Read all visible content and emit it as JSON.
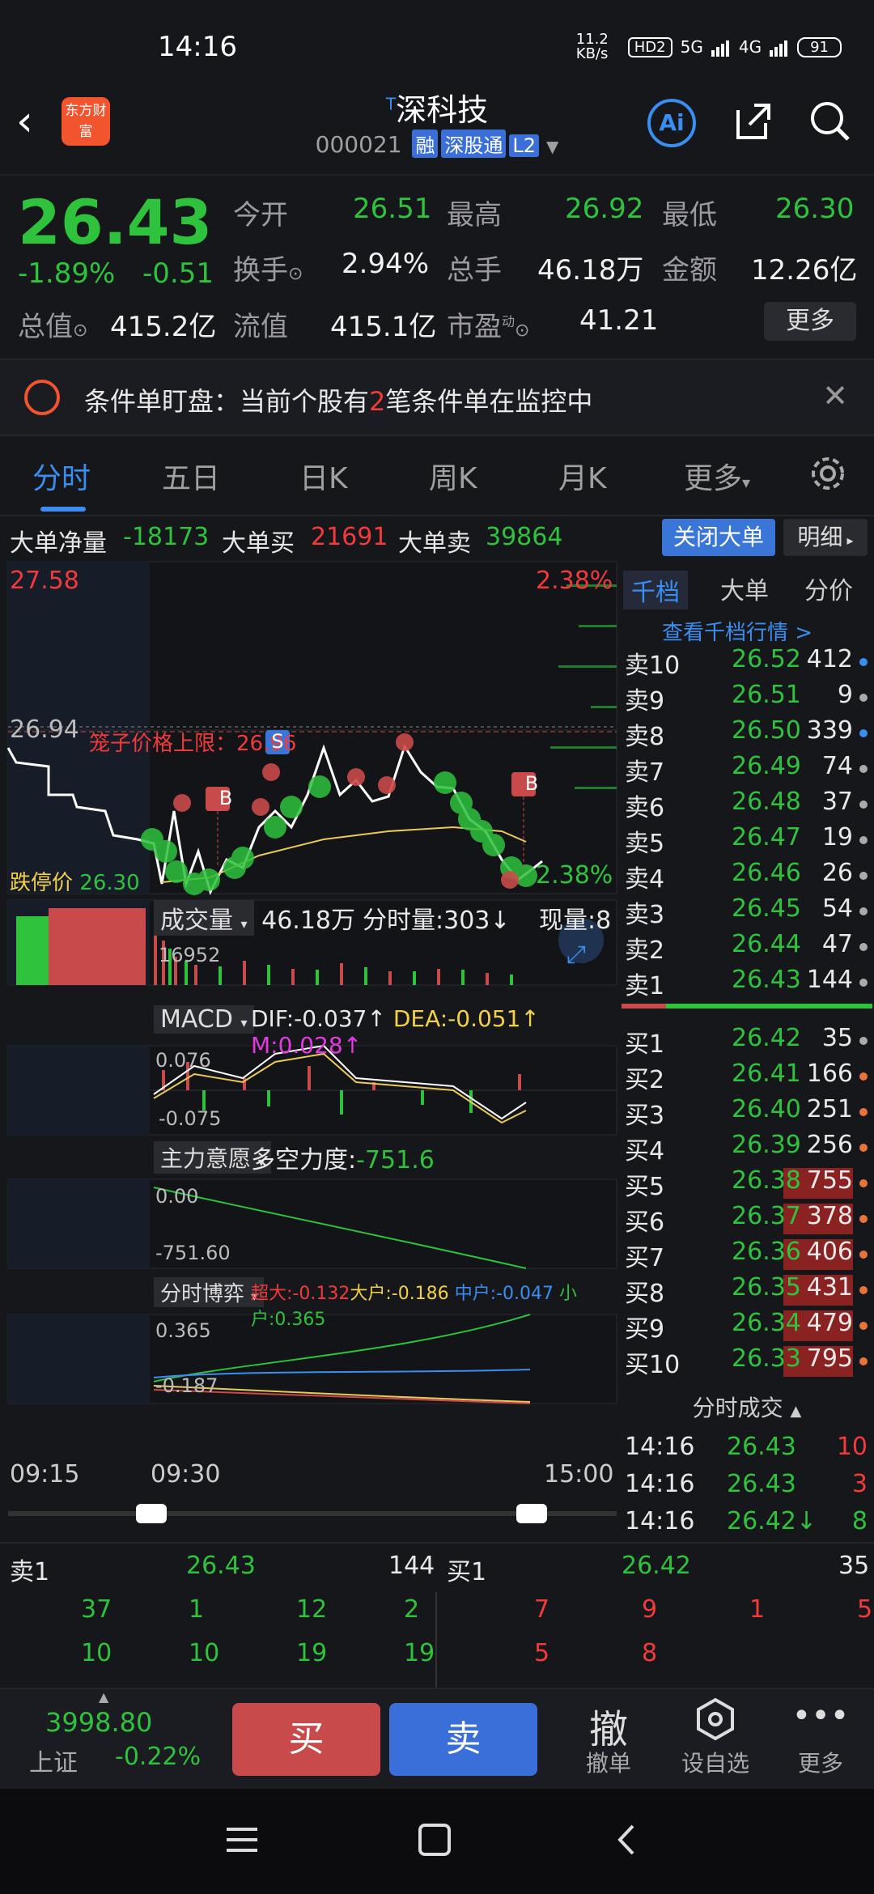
{
  "status": {
    "time": "14:16",
    "net_speed": "11.2 KB/s",
    "hd": "HD2",
    "sig1": "5G",
    "sig2": "4G",
    "battery": "91"
  },
  "header": {
    "logo": "东方财富",
    "title": "深科技",
    "title_sup": "T",
    "code": "000021",
    "tags": [
      "融",
      "深股通",
      "L2"
    ],
    "ai_label": "Ai"
  },
  "quote": {
    "price": "26.43",
    "change_pct": "-1.89%",
    "change": "-0.51",
    "open_label": "今开",
    "open": "26.51",
    "high_label": "最高",
    "high": "26.92",
    "low_label": "最低",
    "low": "26.30",
    "turnover_label": "换手",
    "turnover": "2.94%",
    "volume_label": "总手",
    "volume": "46.18万",
    "amount_label": "金额",
    "amount": "12.26亿",
    "mktcap_label": "总值",
    "mktcap": "415.2亿",
    "float_label": "流值",
    "float": "415.1亿",
    "pe_label": "市盈",
    "pe_sup": "动",
    "pe": "41.21",
    "more": "更多"
  },
  "notice": {
    "prefix": "条件单盯盘：当前个股有",
    "count": "2",
    "suffix": "笔条件单在监控中"
  },
  "tabs": [
    "分时",
    "五日",
    "日K",
    "周K",
    "月K",
    "更多"
  ],
  "bigorder": {
    "net_label": "大单净量",
    "net": "-18173",
    "buy_label": "大单买",
    "buy": "21691",
    "sell_label": "大单卖",
    "sell": "39864",
    "close_btn": "关闭大单",
    "detail_btn": "明细"
  },
  "chart": {
    "price_high": "27.58",
    "pct_high": "2.38%",
    "ref_price": "26.94",
    "cage_label": "笼子价格上限：",
    "cage_val": "26.96",
    "low_label": "跌停价",
    "low_price": "26.30",
    "pct_low": "2.38%",
    "vol_label": "成交量",
    "vol_total": "46.18万",
    "vol_min_label": "分时量:303↓",
    "vol_now_label": "现量:8",
    "vol_max": "16952",
    "macd_label": "MACD",
    "dif": "DIF:-0.037↑",
    "dea": "DEA:-0.051↑",
    "m": "M:0.028↑",
    "macd_hi": "0.076",
    "macd_lo": "-0.075",
    "zl_label": "主力意愿",
    "zl_force_label": "多空力度:",
    "zl_force": "-751.6",
    "zl_hi": "0.00",
    "zl_lo": "-751.60",
    "bo_label": "分时博弈",
    "bo_super": "超大:-0.132",
    "bo_big": "大户:-0.186",
    "bo_mid": "中户:-0.047",
    "bo_small": "小户:0.365",
    "bo_hi": "0.365",
    "bo_lo": "-0.187",
    "t_start": "09:15",
    "t_open": "09:30",
    "t_end": "15:00",
    "mark_b": "B",
    "mark_s": "S"
  },
  "book": {
    "tabs": [
      "千档",
      "大单",
      "分价"
    ],
    "view_more": "查看千档行情 >",
    "sells": [
      {
        "label": "卖10",
        "price": "26.52",
        "vol": "412"
      },
      {
        "label": "卖9",
        "price": "26.51",
        "vol": "9"
      },
      {
        "label": "卖8",
        "price": "26.50",
        "vol": "339"
      },
      {
        "label": "卖7",
        "price": "26.49",
        "vol": "74"
      },
      {
        "label": "卖6",
        "price": "26.48",
        "vol": "37"
      },
      {
        "label": "卖5",
        "price": "26.47",
        "vol": "19"
      },
      {
        "label": "卖4",
        "price": "26.46",
        "vol": "26"
      },
      {
        "label": "卖3",
        "price": "26.45",
        "vol": "54"
      },
      {
        "label": "卖2",
        "price": "26.44",
        "vol": "47"
      },
      {
        "label": "卖1",
        "price": "26.43",
        "vol": "144"
      }
    ],
    "buys": [
      {
        "label": "买1",
        "price": "26.42",
        "vol": "35"
      },
      {
        "label": "买2",
        "price": "26.41",
        "vol": "166"
      },
      {
        "label": "买3",
        "price": "26.40",
        "vol": "251"
      },
      {
        "label": "买4",
        "price": "26.39",
        "vol": "256"
      },
      {
        "label": "买5",
        "price": "26.38",
        "vol": "755"
      },
      {
        "label": "买6",
        "price": "26.37",
        "vol": "378"
      },
      {
        "label": "买7",
        "price": "26.36",
        "vol": "406"
      },
      {
        "label": "买8",
        "price": "26.35",
        "vol": "431"
      },
      {
        "label": "买9",
        "price": "26.34",
        "vol": "479"
      },
      {
        "label": "买10",
        "price": "26.33",
        "vol": "795"
      }
    ],
    "ticks_title": "分时成交",
    "ticks": [
      {
        "time": "14:16",
        "price": "26.43",
        "vol": "10"
      },
      {
        "time": "14:16",
        "price": "26.43",
        "vol": "3"
      },
      {
        "time": "14:16",
        "price": "26.42↓",
        "vol": "8"
      }
    ]
  },
  "bottom_quote": {
    "left_label": "卖1",
    "left_price": "26.43",
    "left_vol": "144",
    "right_label": "买1",
    "right_price": "26.42",
    "right_vol": "35",
    "left_row1": [
      "37",
      "1",
      "12",
      "2"
    ],
    "left_row2": [
      "10",
      "10",
      "19",
      "19"
    ],
    "right_row1": [
      "7",
      "9",
      "1",
      "5"
    ],
    "right_row2": [
      "5",
      "8"
    ]
  },
  "tradebar": {
    "index_value": "3998.80",
    "index_name": "上证",
    "index_change": "-0.22%",
    "buy": "买",
    "sell": "卖",
    "cancel_icon": "撤",
    "cancel": "撤单",
    "fav": "设自选",
    "more": "更多"
  }
}
